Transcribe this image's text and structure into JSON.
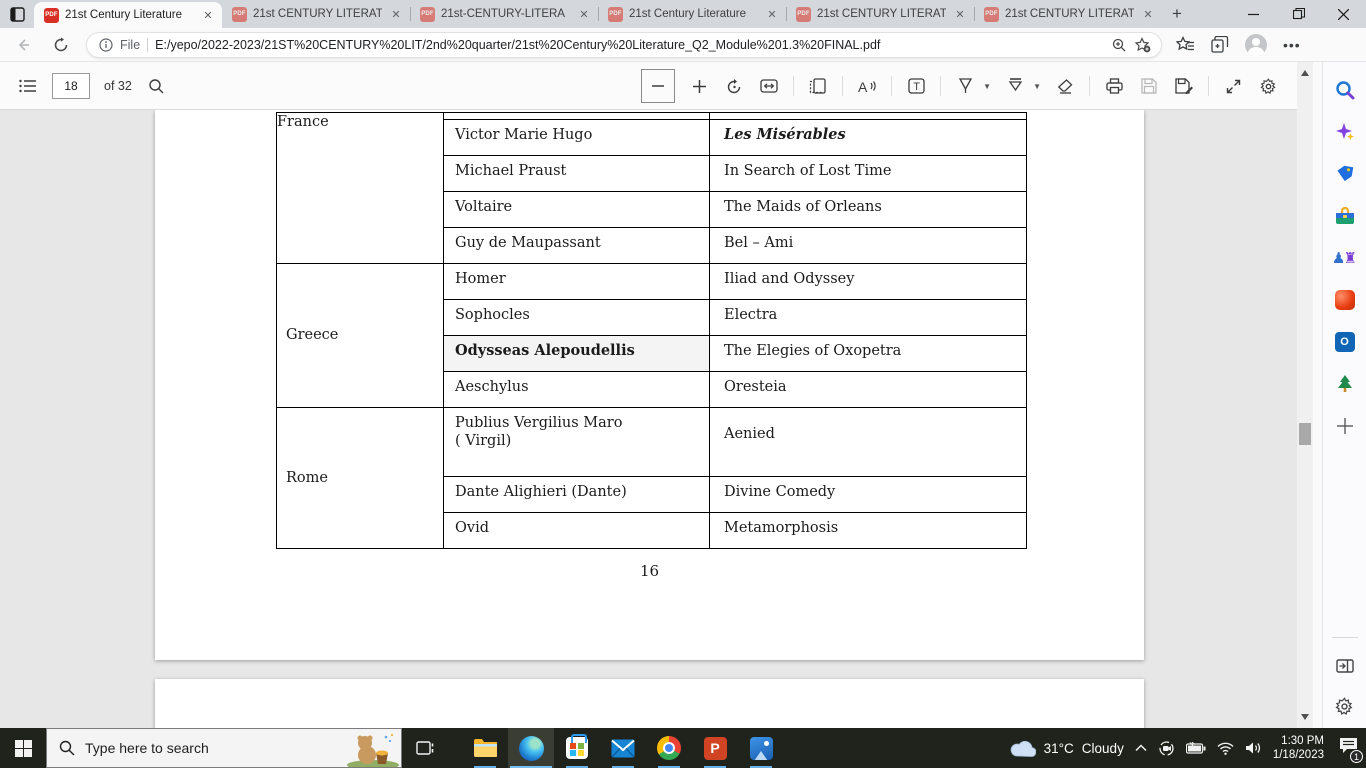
{
  "browser": {
    "tabs": [
      {
        "title": "21st Century Literature",
        "active": true
      },
      {
        "title": "21st CENTURY LITERAT",
        "active": false
      },
      {
        "title": "21st-CENTURY-LITERA",
        "active": false
      },
      {
        "title": "21st Century Literature",
        "active": false
      },
      {
        "title": "21st CENTURY LITERAT",
        "active": false
      },
      {
        "title": "21st CENTURY LITERAT",
        "active": false
      }
    ],
    "address": {
      "scheme_label": "File",
      "url": "E:/yepo/2022-2023/21ST%20CENTURY%20LIT/2nd%20quarter/21st%20Century%20Literature_Q2_Module%201.3%20FINAL.pdf"
    }
  },
  "pdf_toolbar": {
    "page_current": "18",
    "page_total_label": "of 32"
  },
  "document": {
    "table": {
      "groups": [
        {
          "country": "France",
          "label_align": "top",
          "partial_top": true,
          "rows": [
            {
              "author": "Victor Marie Hugo",
              "work": "Les Misérables",
              "work_style": "bold-italic"
            },
            {
              "author": "Michael Praust",
              "work": "In Search of Lost Time"
            },
            {
              "author": "Voltaire",
              "work": "The Maids of Orleans"
            },
            {
              "author": "Guy de Maupassant",
              "work": "Bel – Ami"
            }
          ]
        },
        {
          "country": "Greece",
          "label_align": "middle",
          "rows": [
            {
              "author": "Homer",
              "work": "Iliad and Odyssey"
            },
            {
              "author": "Sophocles",
              "work": "Electra"
            },
            {
              "author": "Odysseas Alepoudellis",
              "author_style": "hl-bold",
              "work": "The Elegies of Oxopetra"
            },
            {
              "author": "Aeschylus",
              "work": "Oresteia"
            }
          ]
        },
        {
          "country": "Rome",
          "label_align": "middle",
          "rows": [
            {
              "author": "Publius Vergilius Maro\n( Virgil)",
              "work": "Aenied",
              "tall": true
            },
            {
              "author": "Dante Alighieri (Dante)",
              "work": "Divine Comedy"
            },
            {
              "author": "Ovid",
              "work": "Metamorphosis"
            }
          ]
        }
      ]
    },
    "page_number": "16"
  },
  "sidebar_icons": [
    "search",
    "discover-copilot",
    "shopping-tag",
    "tools",
    "games",
    "office",
    "outlook",
    "tree",
    "add",
    "collapse-sidebar",
    "settings"
  ],
  "taskbar": {
    "search_placeholder": "Type here to search",
    "weather_temp": "31°C",
    "weather_condition": "Cloudy",
    "time": "1:30 PM",
    "date": "1/18/2023",
    "notification_count": "1"
  },
  "colors": {
    "pdf_icon_red": "#d93025",
    "taskbar_bg": "#20231b",
    "running_indicator": "#6cb2e8",
    "viewer_bg": "#e7e7e7"
  }
}
